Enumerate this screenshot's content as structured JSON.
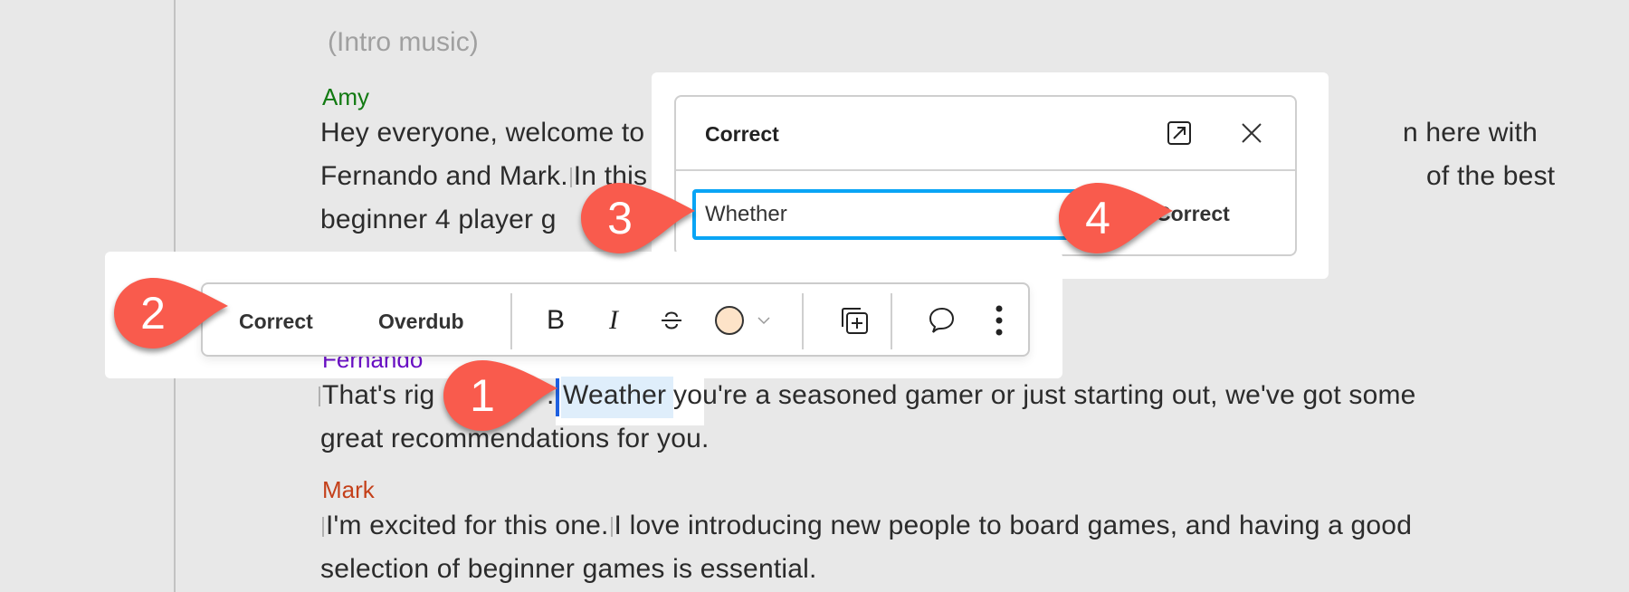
{
  "transcript": {
    "intro": "(Intro music)",
    "blocks": [
      {
        "speaker": "Amy",
        "speaker_color": "#127a12",
        "lines": [
          "Hey everyone, welcome to",
          "n here with",
          "Fernando and Mark.",
          "In this",
          "of the best",
          "beginner 4 player g"
        ]
      },
      {
        "speaker": "Fernando",
        "speaker_color": "#6a0fc6",
        "lines": [
          "That's rig",
          ".",
          "Weather",
          " you're a seasoned gamer or just starting out, we've got some",
          "great recommendations for you."
        ],
        "selected_word": "Weather"
      },
      {
        "speaker": "Mark",
        "speaker_color": "#c4401a",
        "lines": [
          "I'm excited for this one.",
          "I love introducing new people to board games, and having a good",
          "selection of beginner games is essential."
        ]
      }
    ]
  },
  "correct_dialog": {
    "title": "Correct",
    "input_value": "Whether",
    "submit_label": "Correct",
    "icons": [
      "open-external-icon",
      "close-icon"
    ]
  },
  "toolbar": {
    "correct_label": "Correct",
    "overdub_label": "Overdub",
    "bold_glyph": "B",
    "italic_glyph": "I",
    "color_swatch": "#fde3c8",
    "icons": [
      "bold-icon",
      "italic-icon",
      "strikethrough-icon",
      "color-swatch",
      "chevron-down-icon",
      "duplicate-add-icon",
      "comment-icon",
      "more-vertical-icon"
    ]
  },
  "callouts": [
    {
      "number": "1"
    },
    {
      "number": "2"
    },
    {
      "number": "3"
    },
    {
      "number": "4"
    }
  ],
  "colors": {
    "callout": "#f95b4d",
    "input_focus": "#0aa5f5",
    "caret": "#1d5fe0",
    "selection": "#dfeefb"
  }
}
